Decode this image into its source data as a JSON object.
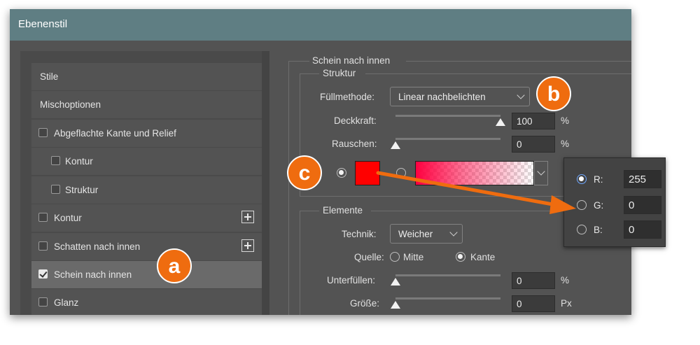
{
  "window": {
    "title": "Ebenenstil"
  },
  "styles": {
    "items": [
      {
        "label": "Stile",
        "checkbox": false
      },
      {
        "label": "Mischoptionen",
        "checkbox": false
      },
      {
        "label": "Abgeflachte Kante und Relief",
        "checkbox": true,
        "checked": false
      },
      {
        "label": "Kontur",
        "checkbox": true,
        "checked": false,
        "indent": true
      },
      {
        "label": "Struktur",
        "checkbox": true,
        "checked": false,
        "indent": true
      },
      {
        "label": "Kontur",
        "checkbox": true,
        "checked": false,
        "add_button": true
      },
      {
        "label": "Schatten nach innen",
        "checkbox": true,
        "checked": false,
        "add_button": true
      },
      {
        "label": "Schein nach innen",
        "checkbox": true,
        "checked": true,
        "selected": true
      },
      {
        "label": "Glanz",
        "checkbox": true,
        "checked": false
      }
    ]
  },
  "inner_glow": {
    "section_title": "Schein nach innen",
    "structure": {
      "group_title": "Struktur",
      "blend_mode_label": "Füllmethode:",
      "blend_mode_value": "Linear nachbelichten",
      "opacity_label": "Deckkraft:",
      "opacity_value": "100",
      "opacity_unit": "%",
      "opacity_fraction": 1.0,
      "noise_label": "Rauschen:",
      "noise_value": "0",
      "noise_unit": "%",
      "noise_fraction": 0.0,
      "solid_color": "#ff0000",
      "gradient_color": "#ff0040"
    },
    "elements": {
      "group_title": "Elemente",
      "technique_label": "Technik:",
      "technique_value": "Weicher",
      "source_label": "Quelle:",
      "source_center": "Mitte",
      "source_edge": "Kante",
      "choke_label": "Unterfüllen:",
      "choke_value": "0",
      "choke_unit": "%",
      "choke_fraction": 0.0,
      "size_label": "Größe:",
      "size_value": "0",
      "size_unit": "Px",
      "size_fraction": 0.0
    }
  },
  "color_popup": {
    "r_label": "R:",
    "r_value": "255",
    "g_label": "G:",
    "g_value": "0",
    "b_label": "B:",
    "b_value": "0"
  },
  "annotations": {
    "a": "a",
    "b": "b",
    "c": "c",
    "color": "#ef6c0f"
  }
}
